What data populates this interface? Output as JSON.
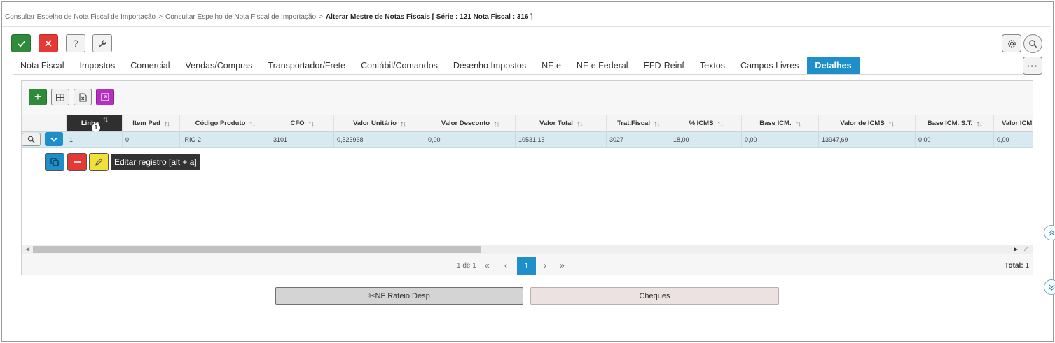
{
  "breadcrumb": {
    "item1": "Consultar Espelho de Nota Fiscal de Importação",
    "item2": "Consultar Espelho de Nota Fiscal de Importação",
    "separator": ">",
    "current": "Alterar Mestre de Notas Fiscais [ Série : 121 Nota Fiscal : 316 ]"
  },
  "toolbar": {
    "confirm_icon": "checkmark-icon",
    "cancel_icon": "x-icon",
    "help_label": "?",
    "tool_icon": "wrench-icon",
    "settings_icon": "gear-icon",
    "search_icon": "search-icon",
    "more_label": "···"
  },
  "tabs": [
    {
      "label": "Nota Fiscal"
    },
    {
      "label": "Impostos"
    },
    {
      "label": "Comercial"
    },
    {
      "label": "Vendas/Compras"
    },
    {
      "label": "Transportador/Frete"
    },
    {
      "label": "Contábil/Comandos"
    },
    {
      "label": "Desenho Impostos"
    },
    {
      "label": "NF-e"
    },
    {
      "label": "NF-e Federal"
    },
    {
      "label": "EFD-Reinf"
    },
    {
      "label": "Textos"
    },
    {
      "label": "Campos Livres"
    },
    {
      "label": "Detalhes",
      "active": true
    }
  ],
  "grid": {
    "toolbar": {
      "add_label": "+",
      "columns_icon": "grid-columns-icon",
      "excel_icon": "excel-export-icon",
      "expand_icon": "expand-icon"
    },
    "columns": [
      {
        "label": "Linha",
        "sort": "↑↓",
        "badge": "1"
      },
      {
        "label": "Item Ped",
        "sort": "↑↓"
      },
      {
        "label": "Código Produto",
        "sort": "↑↓"
      },
      {
        "label": "CFO",
        "sort": "↑↓"
      },
      {
        "label": "Valor Unitário",
        "sort": "↑↓"
      },
      {
        "label": "Valor Desconto",
        "sort": "↑↓"
      },
      {
        "label": "Valor Total",
        "sort": "↑↓"
      },
      {
        "label": "Trat.Fiscal",
        "sort": "↑↓"
      },
      {
        "label": "% ICMS",
        "sort": "↑↓"
      },
      {
        "label": "Base ICM.",
        "sort": "↑↓"
      },
      {
        "label": "Valor de ICMS",
        "sort": "↑↓"
      },
      {
        "label": "Base ICM. S.T.",
        "sort": "↑↓"
      },
      {
        "label": "Valor ICMS",
        "sort": ""
      }
    ],
    "rows": [
      [
        "1",
        "0",
        ".RIC-2",
        "3101",
        "0,523938",
        "0,00",
        "10531,15",
        "3027",
        "18,00",
        "0,00",
        "13947,69",
        "0,00",
        "0,00"
      ]
    ],
    "row_actions": {
      "search_icon": "search-icon",
      "expand_icon": "chevron-down-icon",
      "copy_icon": "copy-icon",
      "delete_icon": "minus-icon",
      "edit_icon": "pencil-icon",
      "edit_tooltip": "Editar registro [alt + a]"
    },
    "pager": {
      "info": "1 de 1",
      "first": "«",
      "prev": "‹",
      "current_page": "1",
      "next": "›",
      "last": "»",
      "total_label": "Total:",
      "total_value": "1"
    }
  },
  "buttons": {
    "rateio": "✂NF Rateio Desp",
    "cheques": "Cheques"
  },
  "colors": {
    "accent": "#1f8fc9",
    "confirm": "#2e8b3a",
    "cancel": "#e53935",
    "expand": "#b52fc0",
    "edit": "#f1e03a",
    "row_highlight": "#d7eaf2"
  }
}
